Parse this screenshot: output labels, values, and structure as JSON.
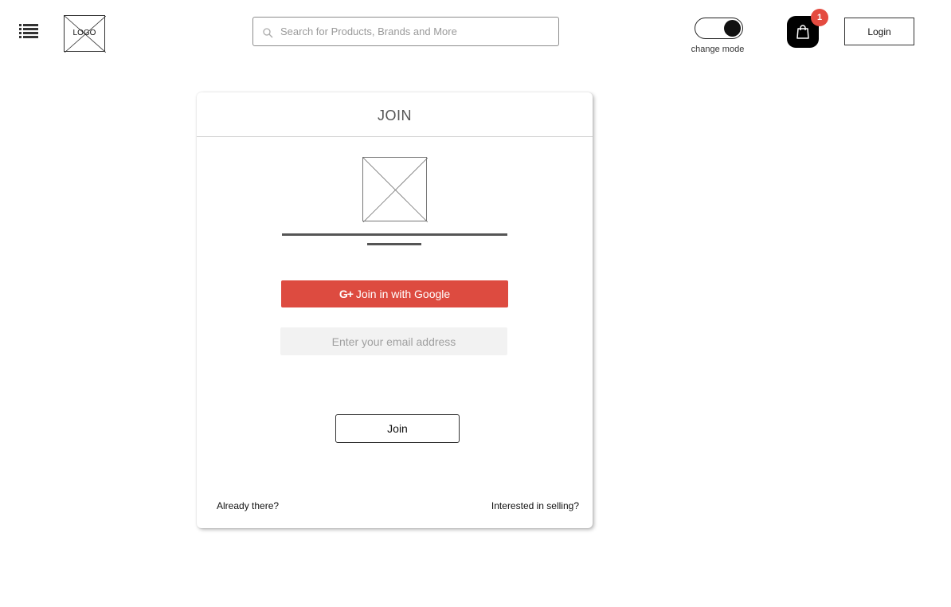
{
  "header": {
    "menu_icon": "list-menu-icon",
    "logo_text": "LOGO",
    "search": {
      "placeholder": "Search for Products, Brands and More",
      "value": "",
      "icon": "search-icon"
    },
    "mode_toggle": {
      "label": "change mode",
      "state": "on"
    },
    "cart": {
      "icon": "shopping-bag-icon",
      "badge_count": "1",
      "badge_color": "#e44b40"
    },
    "login_label": "Login"
  },
  "join_card": {
    "title": "JOIN",
    "google_button": {
      "label": "Join in with Google",
      "icon_text": "G+",
      "color": "#dd4b40"
    },
    "email_input": {
      "placeholder": "Enter your email address",
      "value": ""
    },
    "join_button_label": "Join",
    "footer": {
      "left_link": "Already there?",
      "right_link": "Interested in selling?"
    }
  }
}
